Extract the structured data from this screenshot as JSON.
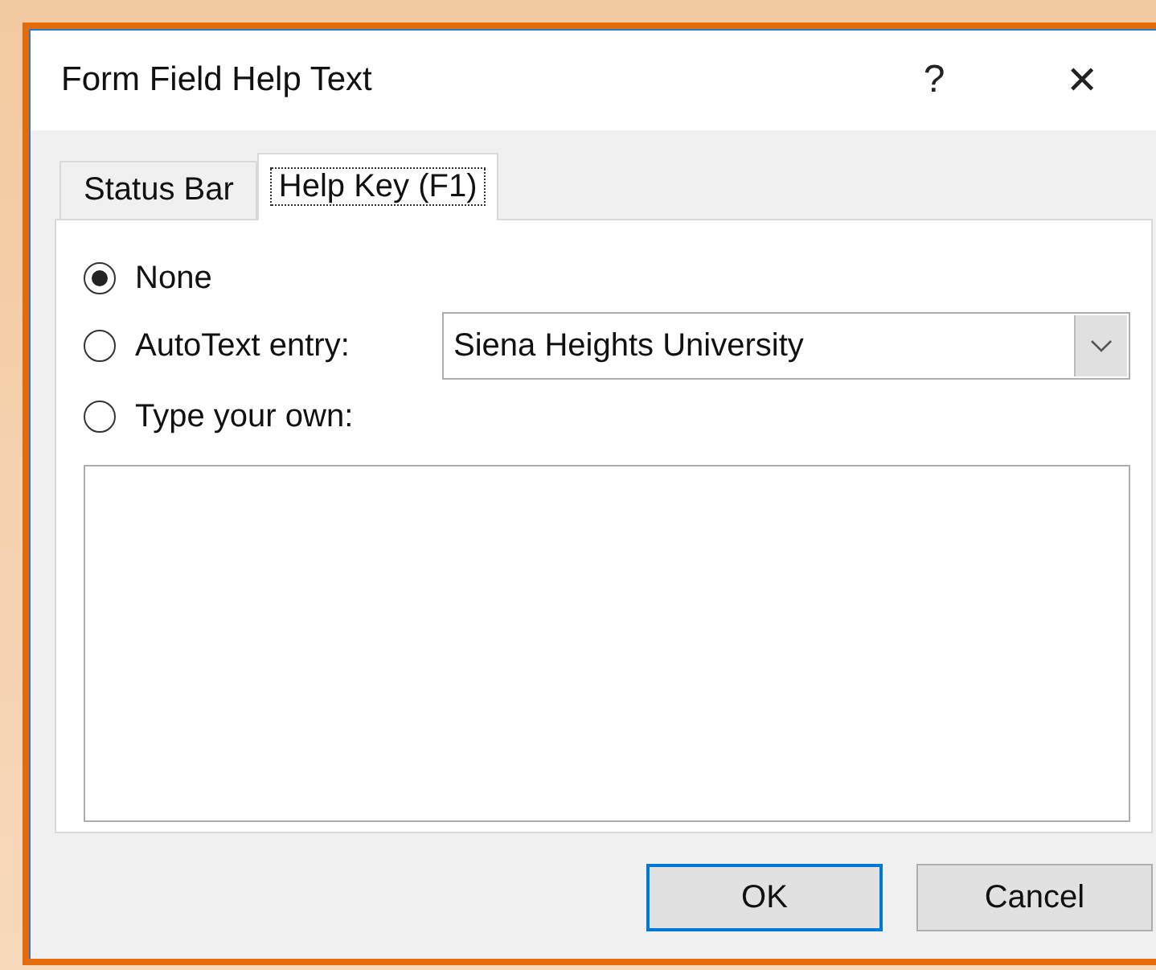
{
  "window": {
    "title": "Form Field Help Text",
    "help": "?",
    "close": "✕"
  },
  "tabs": [
    {
      "label": "Status Bar",
      "selected": false
    },
    {
      "label": "Help Key (F1)",
      "selected": true
    }
  ],
  "options": [
    {
      "label": "None",
      "selected": true
    },
    {
      "label": "AutoText entry:",
      "selected": false
    },
    {
      "label": "Type your own:",
      "selected": false
    }
  ],
  "autotext": {
    "value": "Siena Heights University"
  },
  "buttons": [
    {
      "label": "OK",
      "default": true
    },
    {
      "label": "Cancel",
      "default": false
    }
  ]
}
